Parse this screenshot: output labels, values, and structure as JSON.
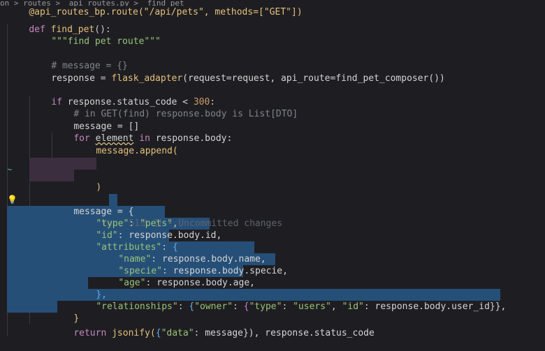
{
  "breadcrumb": {
    "items": [
      "on > routes >",
      "api_routes.py >",
      "find_pet"
    ]
  },
  "code": {
    "line0": "@api_routes_bp.route(\"/api/pets\", methods=[\"GET\"])",
    "line1_kw": "def",
    "line1_fn": "find_pet",
    "line1_rest": "():",
    "line2_doc": "\"\"\"find pet route\"\"\"",
    "line4_cm": "# message = {}",
    "line5_var": "response",
    "line5_eq": " = ",
    "line5_fn": "flask_adapter",
    "line5_args": "(request=request, api_route=find_pet_composer())",
    "line7_kw": "if",
    "line7_rest": " response.status_code < ",
    "line7_num": "300",
    "line7_colon": ":",
    "line8_cm": "# in GET(find) response.body is List[DTO]",
    "line9": "message = []",
    "line10_kw1": "for",
    "line10_var": "element",
    "line10_kw2": "in",
    "line10_rest": " response.body:",
    "line11": "message.append(",
    "line13": ")",
    "line15_var": "message = {",
    "blame": "You, 51초 전 • Uncommitted changes",
    "line16_key": "\"type\"",
    "line16_val": "\"pets\"",
    "line17_key": "\"id\"",
    "line17_val": "response.body.id,",
    "line18_key": "\"attributes\"",
    "line18_val": "{",
    "line19_key": "\"name\"",
    "line19_val": "response.body.name,",
    "line20_key": "\"specie\"",
    "line20_val": "response.body.specie,",
    "line21_key": "\"age\"",
    "line21_val": "response.body.age,",
    "line22": "},",
    "line23_key": "\"relationships\"",
    "line23_owner": "\"owner\"",
    "line23_type": "\"type\"",
    "line23_users": "\"users\"",
    "line23_id": "\"id\"",
    "line23_val": "response.body.user_id}},",
    "line24": "}",
    "line25_kw": "return",
    "line25_fn": "jsonify",
    "line25_data": "\"data\"",
    "line25_rest": "message}), response.status_code"
  },
  "colors": {
    "background": "#1e1e22",
    "selection": "#264f78",
    "keyword": "#c586c0",
    "string": "#98c379",
    "function": "#e5c07b"
  },
  "icons": {
    "lightbulb": "lightbulb-icon",
    "change-marker": "tilde-icon"
  }
}
